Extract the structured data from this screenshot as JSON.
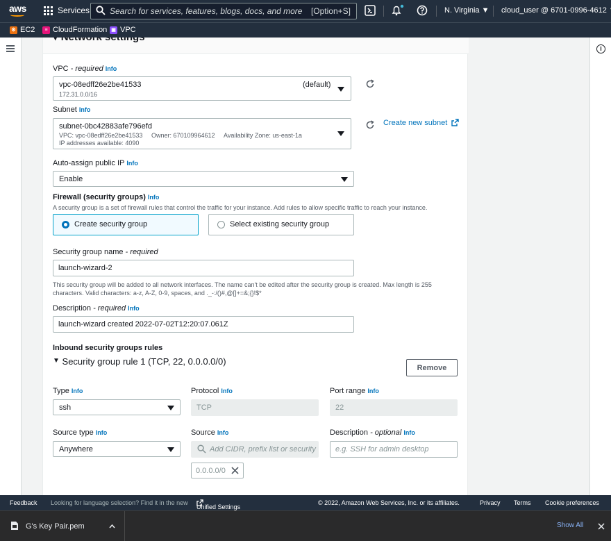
{
  "nav": {
    "logo_text": "aws",
    "services_label": "Services",
    "search_placeholder": "Search for services, features, blogs, docs, and more",
    "search_shortcut": "[Option+S]",
    "region": "N. Virginia ▼",
    "account": "cloud_user @ 6701-0996-4612 ▼"
  },
  "favorites": [
    {
      "label": "EC2",
      "color": "#ec7211",
      "glyph": "⚙"
    },
    {
      "label": "CloudFormation",
      "color": "#e7157b",
      "glyph": "≡"
    },
    {
      "label": "VPC",
      "color": "#8c4fff",
      "glyph": "▣"
    }
  ],
  "section_title": "▾ Network settings",
  "vpc": {
    "label": "VPC",
    "req": " - required",
    "info": "Info",
    "value": "vpc-08edff26e2be41533",
    "tag": "(default)",
    "sub": "172.31.0.0/16"
  },
  "subnet": {
    "label": "Subnet",
    "info": "Info",
    "value": "subnet-0bc42883afe796efd",
    "meta_vpc": "VPC: vpc-08edff26e2be41533",
    "meta_owner": "Owner: 670109964612",
    "meta_az": "Availability Zone: us-east-1a",
    "meta_ips": "IP addresses available: 4090",
    "create_link": "Create new subnet"
  },
  "auto_ip": {
    "label": "Auto-assign public IP",
    "info": "Info",
    "value": "Enable"
  },
  "firewall": {
    "label": "Firewall (security groups)",
    "info": "Info",
    "desc": "A security group is a set of firewall rules that control the traffic for your instance. Add rules to allow specific traffic to reach your instance.",
    "option_create": "Create security group",
    "option_select": "Select existing security group"
  },
  "sg_name": {
    "label": "Security group name",
    "req": " - required",
    "value": "launch-wizard-2",
    "help_1": "This security group will be added to all network interfaces. The name can't be edited after the security group is created. Max length is 255",
    "help_2": "characters. Valid characters: a-z, A-Z, 0-9, spaces, and ._-:/()#,@[]+=&;{}!$*"
  },
  "sg_desc": {
    "label": "Description",
    "req": " - required",
    "info": "Info",
    "value": "launch-wizard created 2022-07-02T12:20:07.061Z"
  },
  "inbound": {
    "heading": "Inbound security groups rules",
    "rule_title": "Security group rule 1 (TCP, 22, 0.0.0.0/0)",
    "remove_label": "Remove",
    "type_label": "Type",
    "type_value": "ssh",
    "protocol_label": "Protocol",
    "protocol_value": "TCP",
    "port_label": "Port range",
    "port_value": "22",
    "source_type_label": "Source type",
    "source_type_value": "Anywhere",
    "source_label": "Source",
    "source_placeholder": "Add CIDR, prefix list or security",
    "source_token": "0.0.0.0/0",
    "desc_label": "Description",
    "desc_optional": " - optional",
    "desc_placeholder": "e.g. SSH for admin desktop",
    "info": "Info"
  },
  "footer": {
    "feedback": "Feedback",
    "lang_prompt": "Looking for language selection? Find it in the new",
    "unified": "Unified Settings",
    "copyright": "© 2022, Amazon Web Services, Inc. or its affiliates.",
    "privacy": "Privacy",
    "terms": "Terms",
    "cookie": "Cookie preferences"
  },
  "download": {
    "file": "G's Key Pair.pem",
    "show_all": "Show All"
  }
}
